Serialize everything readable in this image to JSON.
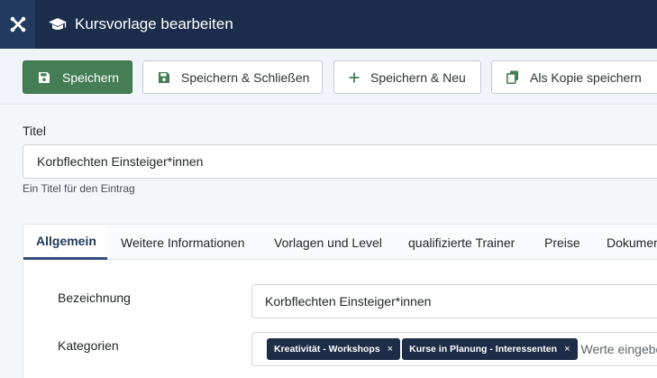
{
  "header": {
    "logo_icon": "joomla-logo-icon",
    "title_icon": "graduation-cap-icon",
    "title": "Kursvorlage bearbeiten",
    "colors": {
      "bar": "#1c2d4b",
      "logo_bg": "#233a60"
    }
  },
  "toolbar": {
    "save_label": "Speichern",
    "save_close_label": "Speichern & Schließen",
    "save_new_label": "Speichern & Neu",
    "save_copy_label": "Als Kopie speichern",
    "colors": {
      "save_bg": "#457d54"
    }
  },
  "title_field": {
    "label": "Titel",
    "value": "Korbflechten Einsteiger*innen",
    "hint": "Ein Titel für den Eintrag"
  },
  "tabs": [
    {
      "label": "Allgemein",
      "active": true
    },
    {
      "label": "Weitere Informationen",
      "active": false
    },
    {
      "label": "Vorlagen und Level",
      "active": false
    },
    {
      "label": "qualifizierte Trainer",
      "active": false
    },
    {
      "label": "Preise",
      "active": false
    },
    {
      "label": "Dokumente",
      "active": false
    }
  ],
  "form": {
    "bezeichnung": {
      "label": "Bezeichnung",
      "value": "Korbflechten Einsteiger*innen"
    },
    "kategorien": {
      "label": "Kategorien",
      "chips": [
        "Kreativität - Workshops",
        "Kurse in Planung - Interessenten"
      ],
      "remove_glyph": "×",
      "placeholder": "Werte eingeben"
    }
  }
}
